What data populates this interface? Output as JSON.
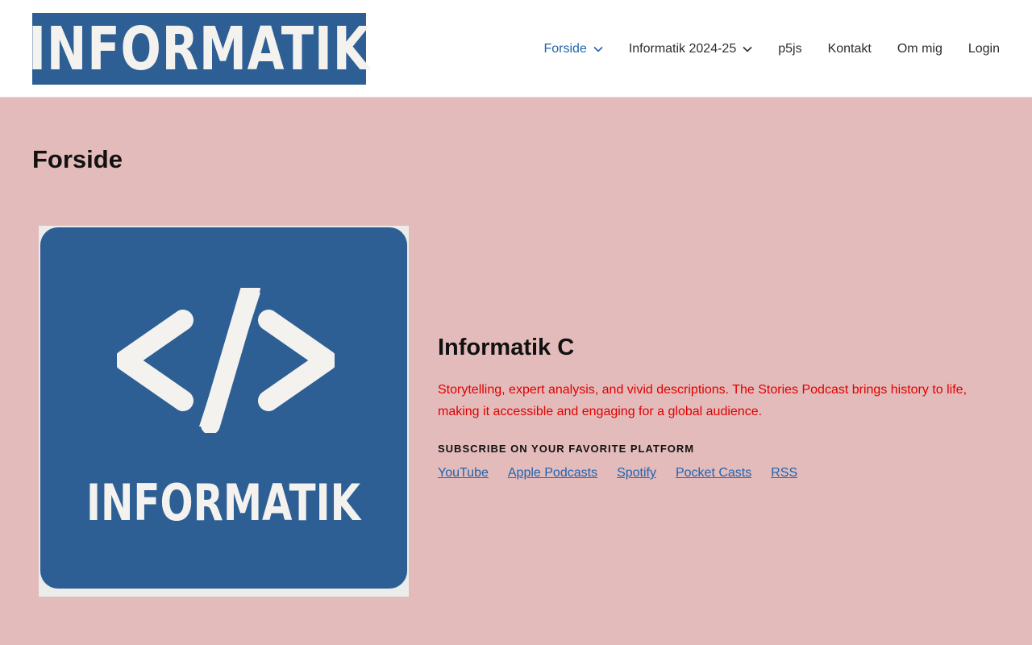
{
  "header": {
    "logo_text": "INFORMATIK",
    "nav": [
      {
        "label": "Forside",
        "has_dropdown": true,
        "active": true
      },
      {
        "label": "Informatik 2024-25",
        "has_dropdown": true,
        "active": false
      },
      {
        "label": "p5js",
        "has_dropdown": false,
        "active": false
      },
      {
        "label": "Kontakt",
        "has_dropdown": false,
        "active": false
      },
      {
        "label": "Om mig",
        "has_dropdown": false,
        "active": false
      },
      {
        "label": "Login",
        "has_dropdown": false,
        "active": false
      }
    ]
  },
  "main": {
    "page_title": "Forside",
    "cover": {
      "code_symbol": "code-brackets-icon",
      "word": "INFORMATIK"
    },
    "podcast": {
      "title": "Informatik C",
      "description": "Storytelling, expert analysis, and vivid descriptions. The Stories Podcast brings history to life, making it accessible and engaging for a global audience.",
      "subscribe_label": "SUBSCRIBE ON YOUR FAVORITE PLATFORM",
      "platforms": [
        "YouTube",
        "Apple Podcasts",
        "Spotify",
        "Pocket Casts",
        "RSS"
      ]
    }
  },
  "colors": {
    "brand_blue": "#2d5f95",
    "link_blue": "#1f63ad",
    "background": "#e4bbbb",
    "description_red": "#e00000"
  }
}
